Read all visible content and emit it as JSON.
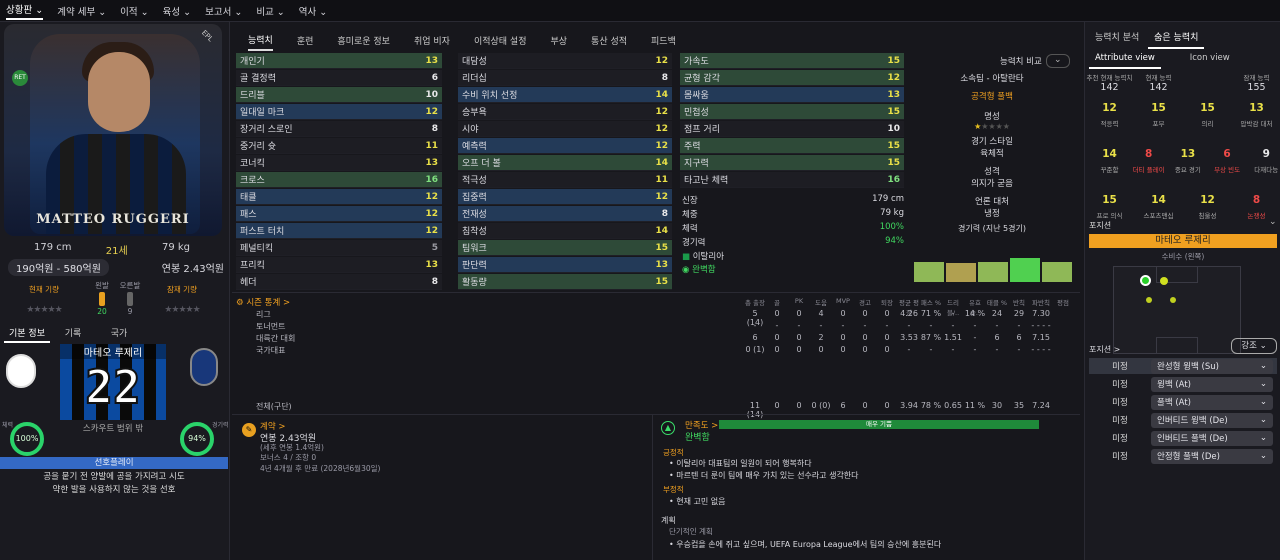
{
  "topnav": [
    "상황판 ⌄",
    "계약 세부 ⌄",
    "이적 ⌄",
    "육성 ⌄",
    "보고서 ⌄",
    "비교 ⌄",
    "역사 ⌄"
  ],
  "player": {
    "card_name": "MATTEO RUGGERI",
    "card_badge": "EPL",
    "level_badge": "RET",
    "height": "179 cm",
    "age": "21세",
    "weight": "79 kg",
    "value": "190억원 - 580억원",
    "wage": "연봉 2.43억원",
    "current_ability_label": "현재 기량",
    "potential_ability_label": "잠재 기량",
    "left_foot_label": "왼발",
    "right_foot_label": "오른발",
    "left_foot_value": "20",
    "right_foot_value": "9",
    "name_kr": "마테오 루제리",
    "squad_number": "22",
    "scout_label": "스카우트 범위 밖",
    "left_ring_value": "100%",
    "right_ring_value": "94%",
    "left_ring_label": "체력",
    "right_ring_label": "경기력",
    "pref_move_label": "선호플레이",
    "pref_move_text1": "공을 뭍기 전 양발에 공을 가지려고 시도",
    "pref_move_text2": "약한 발을 사용하지 않는 것을 선호"
  },
  "left_tabs": [
    "기본 정보",
    "기록",
    "국가"
  ],
  "main_tabs": [
    "능력치",
    "훈련",
    "흥미로운 정보",
    "취업 비자",
    "이적상태 설정",
    "부상",
    "통산 성적",
    "피드백"
  ],
  "attributes": {
    "col1": [
      {
        "name": "개인기",
        "value": "13",
        "hl": "g",
        "vc": "y"
      },
      {
        "name": "골 결정력",
        "value": "6",
        "hl": "n",
        "vc": "w"
      },
      {
        "name": "드리블",
        "value": "10",
        "hl": "g",
        "vc": "w"
      },
      {
        "name": "일대일 마크",
        "value": "12",
        "hl": "b",
        "vc": "y"
      },
      {
        "name": "장거리 스로인",
        "value": "8",
        "hl": "n",
        "vc": "w"
      },
      {
        "name": "중거리 슛",
        "value": "11",
        "hl": "n",
        "vc": "y"
      },
      {
        "name": "코너킥",
        "value": "13",
        "hl": "n",
        "vc": "y"
      },
      {
        "name": "크로스",
        "value": "16",
        "hl": "g",
        "vc": "lg"
      },
      {
        "name": "태클",
        "value": "12",
        "hl": "b",
        "vc": "y"
      },
      {
        "name": "패스",
        "value": "12",
        "hl": "b",
        "vc": "y"
      },
      {
        "name": "퍼스트 터치",
        "value": "12",
        "hl": "b",
        "vc": "y"
      },
      {
        "name": "페널티킥",
        "value": "5",
        "hl": "n",
        "vc": "gr"
      },
      {
        "name": "프리킥",
        "value": "13",
        "hl": "n",
        "vc": "y"
      },
      {
        "name": "헤더",
        "value": "8",
        "hl": "n",
        "vc": "w"
      }
    ],
    "col2": [
      {
        "name": "대담성",
        "value": "12",
        "hl": "n",
        "vc": "y"
      },
      {
        "name": "리더십",
        "value": "8",
        "hl": "n",
        "vc": "w"
      },
      {
        "name": "수비 위치 선정",
        "value": "14",
        "hl": "b",
        "vc": "y"
      },
      {
        "name": "승부욕",
        "value": "12",
        "hl": "n",
        "vc": "y"
      },
      {
        "name": "시야",
        "value": "12",
        "hl": "n",
        "vc": "y"
      },
      {
        "name": "예측력",
        "value": "12",
        "hl": "b",
        "vc": "y"
      },
      {
        "name": "오프 더 볼",
        "value": "14",
        "hl": "g",
        "vc": "y"
      },
      {
        "name": "적극성",
        "value": "11",
        "hl": "n",
        "vc": "y"
      },
      {
        "name": "집중력",
        "value": "12",
        "hl": "b",
        "vc": "y"
      },
      {
        "name": "전재성",
        "value": "8",
        "hl": "b",
        "vc": "w"
      },
      {
        "name": "침착성",
        "value": "14",
        "hl": "n",
        "vc": "y"
      },
      {
        "name": "팀워크",
        "value": "15",
        "hl": "g",
        "vc": "y"
      },
      {
        "name": "판단력",
        "value": "13",
        "hl": "b",
        "vc": "y"
      },
      {
        "name": "활동량",
        "value": "15",
        "hl": "g",
        "vc": "y"
      }
    ],
    "col3": [
      {
        "name": "가속도",
        "value": "15",
        "hl": "g",
        "vc": "y"
      },
      {
        "name": "균형 감각",
        "value": "12",
        "hl": "g",
        "vc": "y"
      },
      {
        "name": "몸싸움",
        "value": "13",
        "hl": "b",
        "vc": "y"
      },
      {
        "name": "민첩성",
        "value": "15",
        "hl": "g",
        "vc": "y"
      },
      {
        "name": "점프 거리",
        "value": "10",
        "hl": "n",
        "vc": "w"
      },
      {
        "name": "주력",
        "value": "15",
        "hl": "g",
        "vc": "y"
      },
      {
        "name": "지구력",
        "value": "15",
        "hl": "g",
        "vc": "y"
      },
      {
        "name": "타고난 체력",
        "value": "16",
        "hl": "n",
        "vc": "lg"
      }
    ]
  },
  "compare_label": "능력치 비교",
  "club_info": {
    "club": "소속팀 - 아탈란타",
    "role": "공격형 풀백",
    "rep_label": "명성",
    "style_label": "경기 스타일",
    "style_value": "육체적",
    "personality_label": "성격",
    "personality_value": "의지가 굳음",
    "media_label": "언론 대처",
    "media_value": "냉정",
    "form_label": "경기력 (지난 5경기)"
  },
  "physical": {
    "height_label": "신장",
    "height_value": "179 cm",
    "weight_label": "체중",
    "weight_value": "79 kg",
    "cond_label": "체력",
    "cond_value": "100%",
    "form_label": "경기력",
    "form_value": "94%",
    "nation": "이탈리아",
    "fit": "완벽함"
  },
  "season": {
    "title": "시즌 통계 >",
    "headers": [
      "총 출장",
      "골",
      "PK",
      "도움",
      "MVP",
      "경고",
      "퇴장",
      "평균 평점",
      "패스 %",
      "드리블/..",
      "유효 슛..",
      "태클 %",
      "반칙",
      "파반칙",
      "평점"
    ],
    "rows": [
      {
        "label": "리그",
        "vals": [
          "5 (14)",
          "0",
          "0",
          "4",
          "0",
          "0",
          "0",
          "4.26",
          "71 %",
          "-",
          "14 %",
          "24",
          "29",
          "7.30"
        ]
      },
      {
        "label": "토너먼트",
        "vals": [
          "-",
          "-",
          "-",
          "-",
          "-",
          "-",
          "-",
          "-",
          "-",
          "-",
          "-",
          "-",
          "-",
          "- - - -"
        ]
      },
      {
        "label": "대륙간 대회",
        "vals": [
          "6",
          "0",
          "0",
          "2",
          "0",
          "0",
          "0",
          "3.53",
          "87 %",
          "1.51",
          "-",
          "6",
          "6",
          "7.15"
        ]
      },
      {
        "label": "국가대표",
        "vals": [
          "0 (1)",
          "0",
          "0",
          "0",
          "0",
          "0",
          "0",
          "-",
          "-",
          "-",
          "-",
          "-",
          "-",
          "- - - -"
        ]
      }
    ],
    "total_label": "전체(구단)",
    "total_vals": [
      "11 (14)",
      "0",
      "0",
      "0 (0)",
      "6",
      "0",
      "0",
      "3.94",
      "78 %",
      "0.65",
      "11 %",
      "30",
      "35",
      "7.24"
    ]
  },
  "contract": {
    "title": "계약 >",
    "wage": "연봉 2.43억원",
    "detail1": "(세후 연봉 1.4억원)",
    "detail2": "보너스 4 / 조항 0",
    "expiry": "4년 4개월 후 만료 (2028년6월30일)"
  },
  "happiness": {
    "title": "만족도 >",
    "status": "완벽함",
    "bar_label": "매우 기쁨",
    "pos_label": "긍정적",
    "pos_items": [
      "이탈리아 대표팀의 일원이 되어 행복하다",
      "마르텐 더 룬이 팀에 매우 가치 있는 선수라고 생각한다"
    ],
    "neg_label": "부정적",
    "neg_items": [
      "현재 고민 없음"
    ],
    "plan_label": "계획",
    "plan_sub": "단기적인 계획",
    "plan_items": [
      "우승컵을 손에 쥐고 싶으며, UEFA Europa League에서 팀의 승산에 흥분된다"
    ]
  },
  "right": {
    "tabs": [
      "능력치 분석",
      "숨은 능력치"
    ],
    "view_tabs": [
      "Attribute view",
      "Icon view"
    ],
    "ability_headers": [
      "추천 현재 능력치",
      "현재 능력",
      "잠재 능력"
    ],
    "ability_values": [
      "142",
      "142",
      "155"
    ],
    "grid": [
      [
        {
          "v": "12",
          "l": "적응력",
          "c": "y"
        },
        {
          "v": "15",
          "l": "포부",
          "c": "y"
        },
        {
          "v": "15",
          "l": "의리",
          "c": "y"
        },
        {
          "v": "13",
          "l": "압박감 대처",
          "c": "y"
        }
      ],
      [
        {
          "v": "14",
          "l": "꾸준함",
          "c": "y"
        },
        {
          "v": "8",
          "l": "더티 플레이",
          "c": "r"
        },
        {
          "v": "13",
          "l": "중요 경기",
          "c": "y"
        },
        {
          "v": "6",
          "l": "부상 빈도",
          "c": "r"
        },
        {
          "v": "9",
          "l": "다재다능",
          "c": "w"
        }
      ],
      [
        {
          "v": "15",
          "l": "프로 의식",
          "c": "y"
        },
        {
          "v": "14",
          "l": "스포츠맨십",
          "c": "y"
        },
        {
          "v": "12",
          "l": "침울성",
          "c": "y"
        },
        {
          "v": "8",
          "l": "논쟁성",
          "c": "r"
        }
      ]
    ],
    "position_title": "포지션",
    "player_name": "마테오 루제리",
    "position_desc": "수비수 (왼쪽)",
    "role_title": "포지션 >",
    "filter": "강조",
    "roles": [
      {
        "pos": "미정",
        "role": "완성형 윙백 (Su)"
      },
      {
        "pos": "미정",
        "role": "윙백 (At)"
      },
      {
        "pos": "미정",
        "role": "풀백 (At)"
      },
      {
        "pos": "미정",
        "role": "인버티드 윙백 (De)"
      },
      {
        "pos": "미정",
        "role": "인버티드 풀백 (De)"
      },
      {
        "pos": "미정",
        "role": "안정형 풀백 (De)"
      }
    ]
  },
  "colors": {
    "accent_yellow": "#e9e048",
    "accent_green": "#40d860",
    "accent_orange": "#f0a020",
    "accent_red": "#ef4a48",
    "pref_blue": "#3469c4"
  }
}
